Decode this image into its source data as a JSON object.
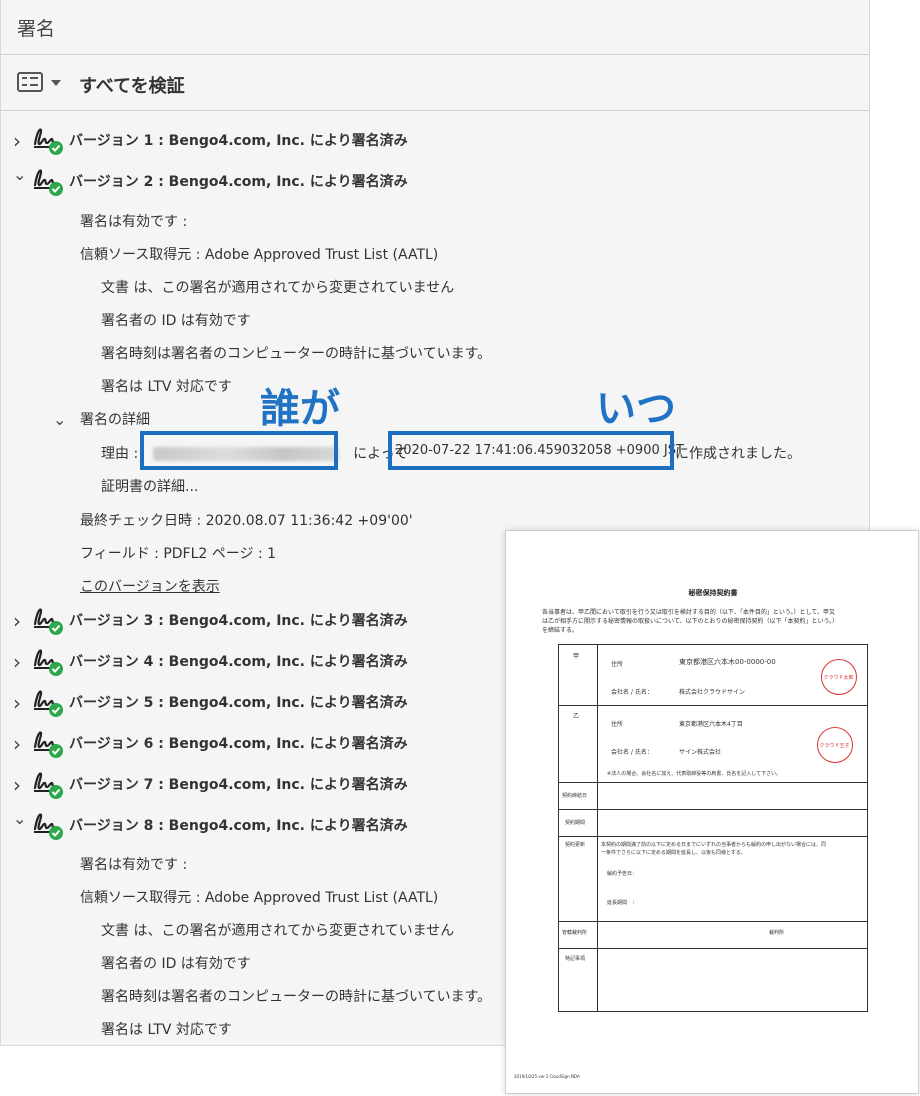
{
  "panel": {
    "title": "署名",
    "verify_all": "すべてを検証"
  },
  "versions": [
    {
      "label": "バージョン 1 : Bengo4.com, Inc. により署名済み",
      "expanded": false
    },
    {
      "label": "バージョン 2 : Bengo4.com, Inc. により署名済み",
      "expanded": true
    },
    {
      "label": "バージョン 3 : Bengo4.com, Inc. により署名済み",
      "expanded": false
    },
    {
      "label": "バージョン 4 : Bengo4.com, Inc. により署名済み",
      "expanded": false
    },
    {
      "label": "バージョン 5 : Bengo4.com, Inc. により署名済み",
      "expanded": false
    },
    {
      "label": "バージョン 6 : Bengo4.com, Inc. により署名済み",
      "expanded": false
    },
    {
      "label": "バージョン 7 : Bengo4.com, Inc. により署名済み",
      "expanded": false
    },
    {
      "label": "バージョン 8 : Bengo4.com, Inc. により署名済み",
      "expanded": true
    }
  ],
  "v2": {
    "valid": "署名は有効です :",
    "trust_source": "信頼ソース取得元 : Adobe Approved Trust List (AATL)",
    "unchanged": "文書 は、この署名が適用されてから変更されていません",
    "id_valid": "署名者の ID は有効です",
    "time_basis": "署名時刻は署名者のコンピューターの時計に基づいています。",
    "ltv": "署名は LTV 対応です",
    "details": "署名の詳細",
    "reason_label": "理由 :",
    "reason_mid": "によって",
    "timestamp": "2020-07-22 17:41:06.459032058 +0900 JST",
    "reason_end": "に作成されました。",
    "cert_details": "証明書の詳細...",
    "last_checked": "最終チェック日時 : 2020.08.07 11:36:42 +09'00'",
    "field": "フィールド : PDFL2  ページ : 1",
    "show_version": "このバージョンを表示"
  },
  "v8": {
    "valid": "署名は有効です :",
    "trust_source": "信頼ソース取得元 : Adobe Approved Trust List (AATL)",
    "unchanged": "文書 は、この署名が適用されてから変更されていません",
    "id_valid": "署名者の ID は有効です",
    "time_basis": "署名時刻は署名者のコンピューターの時計に基づいています。",
    "ltv": "署名は LTV 対応です"
  },
  "annotations": {
    "who": "誰が",
    "when": "いつ"
  },
  "document": {
    "title": "秘密保持契約書",
    "intro1": "各当事者は、甲乙間において取引を行う又は取引を検討する目的（以下、「本件目的」という。）として、甲又",
    "intro2": "は乙が相手方に開示する秘密情報の取扱いについて、以下のとおりの秘密保持契約（以下「本契約」という。）",
    "intro3": "を締結する。",
    "party_a": "甲",
    "party_b": "乙",
    "address_label": "住所",
    "company_label": "会社名 / 氏名：",
    "a_address": "東京都港区六本木00-0000-00",
    "a_company": "株式会社クラウドサイン",
    "b_address": "東京都港区六本木4丁目",
    "b_company": "サイン株式会社",
    "stamp_a": "クラウド太郎",
    "stamp_b": "クラウド五子",
    "party_note": "※法人の場合、会社名に加え、代表取締役等の肩書、氏名を記入して下さい。",
    "row_contract_date": "契約締結日",
    "row_contract_period": "契約期間",
    "row_auto_renewal": "契約更新",
    "renewal_text1": "本契約の期間満了前の以下に定める日までにいずれの当事者からも解約の申し出がない場合には、同",
    "renewal_text2": "一条件でさらに以下に定める期間を延長し、以後も同様とする。",
    "renewal_notice": "解約予告日：",
    "renewal_period": "延長期間　：",
    "row_court": "管轄裁判所",
    "court_value": "裁判所",
    "row_special": "特記事項",
    "footer": "2019/10/25 ver.1 CloudSign NDA"
  },
  "colors": {
    "accent": "#1f72c4",
    "check": "#2aa84a",
    "stamp": "#d33333"
  }
}
